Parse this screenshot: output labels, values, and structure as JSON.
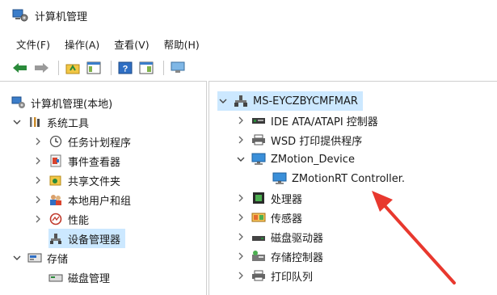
{
  "window": {
    "title": "计算机管理"
  },
  "menu": [
    "文件(F)",
    "操作(A)",
    "查看(V)",
    "帮助(H)"
  ],
  "left_tree": [
    {
      "label": "计算机管理(本地)",
      "icon": "computer-management-icon"
    },
    {
      "label": "系统工具",
      "icon": "tools-icon"
    },
    {
      "label": "任务计划程序",
      "icon": "clock-icon"
    },
    {
      "label": "事件查看器",
      "icon": "event-viewer-icon"
    },
    {
      "label": "共享文件夹",
      "icon": "shared-folder-icon"
    },
    {
      "label": "本地用户和组",
      "icon": "users-icon"
    },
    {
      "label": "性能",
      "icon": "performance-icon"
    },
    {
      "label": "设备管理器",
      "icon": "device-manager-icon"
    },
    {
      "label": "存储",
      "icon": "storage-icon"
    },
    {
      "label": "磁盘管理",
      "icon": "disk-management-icon"
    }
  ],
  "right_tree": [
    {
      "label": "MS-EYCZBYCMFMAR",
      "icon": "computer-icon"
    },
    {
      "label": "IDE ATA/ATAPI 控制器",
      "icon": "ide-controller-icon"
    },
    {
      "label": "WSD 打印提供程序",
      "icon": "printer-icon"
    },
    {
      "label": "ZMotion_Device",
      "icon": "monitor-icon"
    },
    {
      "label": "ZMotionRT Controller.",
      "icon": "monitor-icon"
    },
    {
      "label": "处理器",
      "icon": "processor-icon"
    },
    {
      "label": "传感器",
      "icon": "sensor-icon"
    },
    {
      "label": "磁盘驱动器",
      "icon": "disk-drive-icon"
    },
    {
      "label": "存储控制器",
      "icon": "storage-controller-icon"
    },
    {
      "label": "打印队列",
      "icon": "print-queue-icon"
    }
  ],
  "colors": {
    "selection": "#cce8ff",
    "arrow": "#e8382e",
    "accent": "#1e7fd6"
  }
}
